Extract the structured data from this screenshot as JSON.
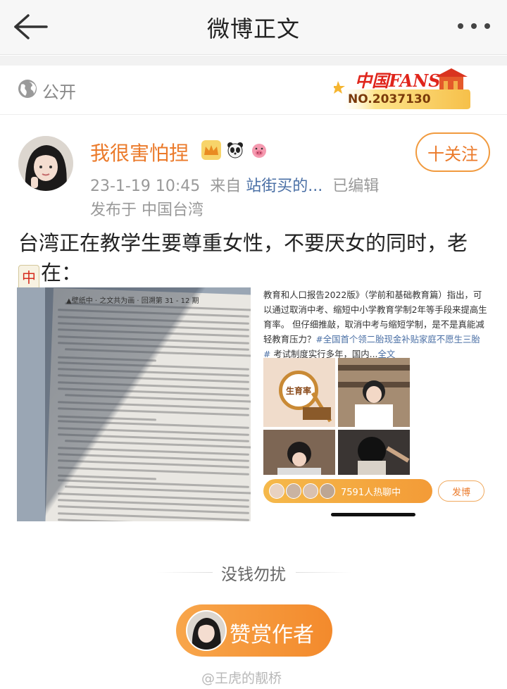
{
  "header": {
    "title": "微博正文",
    "back_icon": "back-arrow-icon",
    "more_icon": "more-dots-icon"
  },
  "visibility": {
    "label": "公开",
    "icon": "globe-icon"
  },
  "fans_badge": {
    "title": "中国FANS",
    "number": "NO.2037130"
  },
  "author": {
    "name": "我很害怕捏",
    "badges": [
      "crown-icon",
      "panda-icon",
      "pig-icon"
    ],
    "time": "23-1-19 10:45",
    "source_prefix": "来自",
    "source": "站街买的...",
    "edited": "已编辑",
    "location": "发布于 中国台湾",
    "follow_label": "十关注"
  },
  "post": {
    "text_main": "台湾正在教学生要尊重女性，不要厌女的同时，老",
    "emoji_label": "中",
    "text_tail": "在："
  },
  "image_left": {
    "header": "▲壁纸中 · 之文共为画 · 回溯第 31 - 12 期"
  },
  "image_right": {
    "body": "教育和人口报告2022版》（学前和基础教育篇）指出，可以通过取消中考、缩短中小学教育学制2年等手段来提高生育率。 但仔细推敲，取消中考与缩短学制，是不是真能减轻教育压力？",
    "tag": "#全国首个领二胎现金补贴家庭不愿生三胎#",
    "tail": " 考试制度实行多年，国内...",
    "full_text": "全文",
    "rate_label": "生育率",
    "live_text": "7591人热聊中",
    "send_label": "发博"
  },
  "reward": {
    "caption": "没钱勿扰",
    "button_label": "赞赏作者"
  },
  "watermark": "@王虎的靓桥",
  "colors": {
    "accent": "#eb7a2a",
    "link": "#4a6fa5",
    "reward_start": "#f8a64b",
    "reward_end": "#f38a2c"
  }
}
